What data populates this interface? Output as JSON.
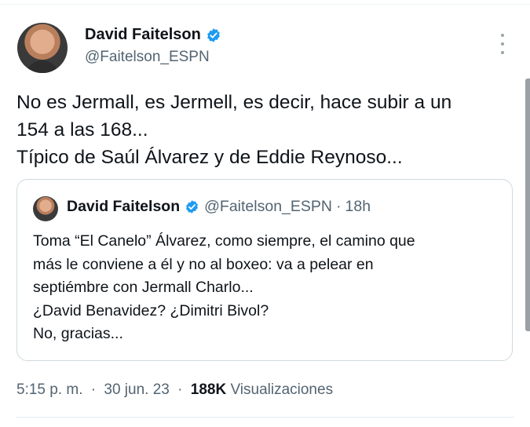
{
  "colors": {
    "verified_blue": "#1d9bf0",
    "secondary_text": "#536471",
    "primary_text": "#0f1419"
  },
  "tweet": {
    "author_name": "David Faitelson",
    "handle": "@Faitelson_ESPN",
    "avatar_icon": "profile-photo",
    "text_lines": [
      "No es Jermall, es Jermell, es decir, hace subir a un",
      "154 a las 168...",
      "Típico de Saúl Álvarez y de Eddie Reynoso..."
    ],
    "time": "5:15 p. m.",
    "date": "30 jun. 23",
    "separator": "·",
    "views_count": "188K",
    "views_label": "Visualizaciones"
  },
  "quoted": {
    "author_name": "David Faitelson",
    "handle": "@Faitelson_ESPN",
    "separator": "·",
    "time": "18h",
    "text_lines": [
      "Toma “El Canelo” Álvarez, como siempre, el camino que",
      "más le conviene a él y no al boxeo: va a pelear en",
      "septiémbre con Jermall Charlo...",
      "¿David Benavidez? ¿Dimitri Bivol?",
      "No, gracias..."
    ]
  }
}
